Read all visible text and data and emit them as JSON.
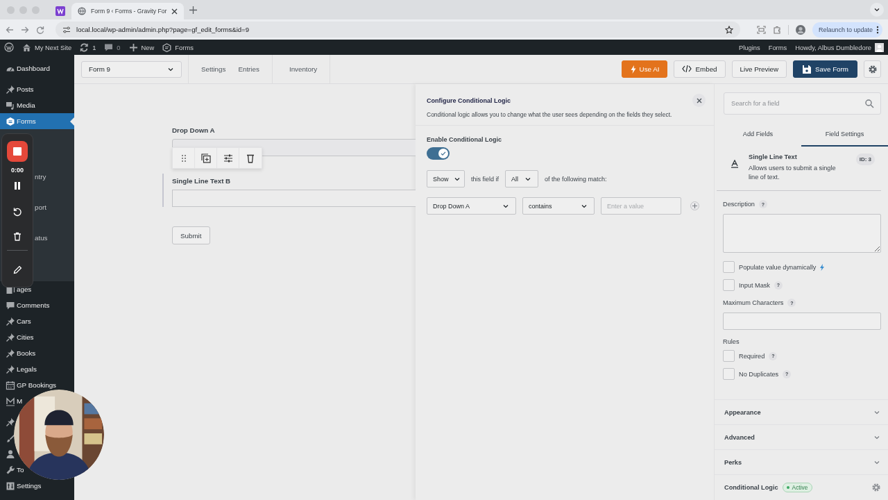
{
  "browser": {
    "tabs": [
      {
        "kind": "favicon",
        "selected": false
      },
      {
        "kind": "page",
        "title": "Form 9 ‹ Forms - Gravity For",
        "selected": true
      }
    ],
    "url": "local.local/wp-admin/admin.php?page=gf_edit_forms&id=9",
    "relaunch": "Relaunch to update"
  },
  "admin_bar": {
    "left": [
      {
        "kind": "logo"
      },
      {
        "kind": "site",
        "label": "My Next Site"
      },
      {
        "kind": "updates",
        "label": "1"
      },
      {
        "kind": "comments",
        "label": "0"
      },
      {
        "kind": "new",
        "label": "New"
      },
      {
        "kind": "forms",
        "label": "Forms"
      }
    ],
    "right": [
      "Plugins",
      "Forms"
    ],
    "greeting": "Howdy, Albus Dumbledore"
  },
  "sidebar": {
    "items": [
      {
        "label": "Dashboard",
        "selected": false
      },
      {
        "label": "Posts",
        "selected": false
      },
      {
        "label": "Media",
        "selected": false
      },
      {
        "label": "Forms",
        "selected": true
      }
    ],
    "submenu": [
      "ntry",
      "port",
      "atus"
    ],
    "items_2": [
      {
        "label": "ages",
        "selected": false
      },
      {
        "label": "Comments",
        "selected": false
      },
      {
        "label": "Cars",
        "selected": false
      },
      {
        "label": "Cities",
        "selected": false
      },
      {
        "label": "Books",
        "selected": false
      },
      {
        "label": "Legals",
        "selected": false
      },
      {
        "label": "GP Bookings",
        "selected": false
      },
      {
        "label": "M",
        "selected": false
      },
      {
        "selected": false
      },
      {
        "selected": false
      },
      {
        "selected": false
      },
      {
        "label": "To",
        "selected": false
      },
      {
        "label": "Settings",
        "selected": false
      }
    ]
  },
  "recorder": {
    "time": "0:00"
  },
  "toolbar": {
    "form_select": "Form 9",
    "links": [
      "Settings",
      "Entries",
      "Inventory"
    ],
    "buttons": [
      {
        "kind": "ai",
        "label": "Use AI"
      },
      {
        "kind": "embed",
        "label": "Embed"
      },
      {
        "kind": "preview",
        "label": "Live Preview"
      },
      {
        "kind": "save",
        "label": "Save Form"
      }
    ]
  },
  "form": {
    "fields": [
      {
        "kind": "select",
        "label": "Drop Down A",
        "selected": false,
        "hovered": true
      },
      {
        "kind": "text",
        "label": "Single Line Text B",
        "selected": true,
        "hovered": false
      }
    ],
    "submit": "Submit"
  },
  "logic_panel": {
    "title": "Configure Conditional Logic",
    "description": "Conditional logic allows you to change what the user sees depending on the fields they select.",
    "enable_label": "Enable Conditional Logic",
    "enabled": true,
    "action": "Show",
    "text_1": "this field if",
    "match": "All",
    "text_2": "of the following match:",
    "rules": [
      {
        "field": "Drop Down A",
        "operator": "contains",
        "value_placeholder": "Enter a value"
      }
    ]
  },
  "settings_panel": {
    "search_placeholder": "Search for a field",
    "tabs": [
      {
        "label": "Add Fields",
        "selected": false
      },
      {
        "label": "Field Settings",
        "selected": true
      }
    ],
    "field": {
      "title": "Single Line Text",
      "description": "Allows users to submit a single line of text.",
      "id_badge": "ID: 3"
    },
    "description": {
      "label": "Description",
      "help": "?"
    },
    "options": [
      {
        "kind": "dynamic",
        "label": "Populate value dynamically",
        "checked": false
      },
      {
        "kind": "help",
        "label": "Input Mask",
        "checked": false,
        "help": "?"
      }
    ],
    "max_chars": {
      "label": "Maximum Characters",
      "help": "?"
    },
    "rules": {
      "label": "Rules",
      "items": [
        {
          "label": "Required",
          "checked": false,
          "help": "?"
        },
        {
          "label": "No Duplicates",
          "checked": false,
          "help": "?"
        }
      ]
    },
    "sections": [
      {
        "label": "Appearance",
        "expanded": false
      },
      {
        "label": "Advanced",
        "expanded": false
      },
      {
        "label": "Perks",
        "expanded": false
      }
    ],
    "conditional_logic": {
      "label": "Conditional Logic",
      "status": "Active"
    }
  }
}
